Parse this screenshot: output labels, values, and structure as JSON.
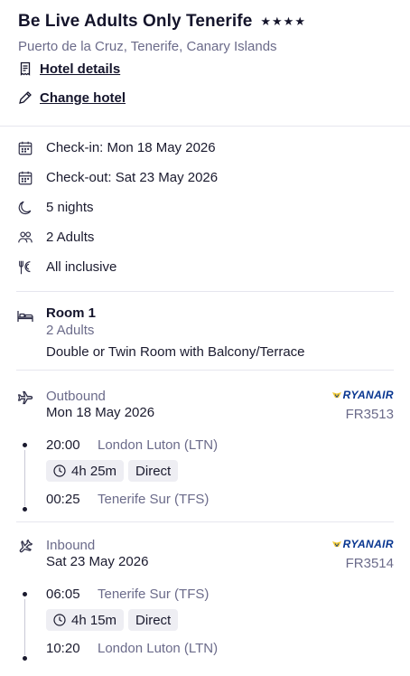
{
  "hotel": {
    "name": "Be Live Adults Only Tenerife",
    "stars": "★★★★",
    "location": "Puerto de la Cruz, Tenerife, Canary Islands",
    "details_link": "Hotel details",
    "change_link": "Change hotel"
  },
  "stay": {
    "checkin": "Check-in: Mon 18 May 2026",
    "checkout": "Check-out: Sat 23 May 2026",
    "nights": "5 nights",
    "guests": "2 Adults",
    "board": "All inclusive"
  },
  "room": {
    "title": "Room 1",
    "guests": "2 Adults",
    "type": "Double or Twin Room with Balcony/Terrace"
  },
  "outbound": {
    "label": "Outbound",
    "date": "Mon 18 May 2026",
    "airline": "RYANAIR",
    "flight_no": "FR3513",
    "depart_time": "20:00",
    "depart_place": "London Luton (LTN)",
    "duration": "4h 25m",
    "stops": "Direct",
    "arrive_time": "00:25",
    "arrive_place": "Tenerife Sur (TFS)"
  },
  "inbound": {
    "label": "Inbound",
    "date": "Sat 23 May 2026",
    "airline": "RYANAIR",
    "flight_no": "FR3514",
    "depart_time": "06:05",
    "depart_place": "Tenerife Sur (TFS)",
    "duration": "4h 15m",
    "stops": "Direct",
    "arrive_time": "10:20",
    "arrive_place": "London Luton (LTN)"
  },
  "colors": {
    "brand_ryanair": "#073590",
    "harp_yellow": "#f1c933",
    "text_primary": "#14142b",
    "text_secondary": "#6b6b8a",
    "chip_bg": "#eeeef3"
  },
  "icons": {
    "details": "receipt-icon",
    "change": "pencil-icon",
    "checkin": "calendar-icon",
    "checkout": "calendar-icon",
    "nights": "moon-icon",
    "guests": "people-icon",
    "board": "cutlery-icon",
    "room": "bed-icon",
    "outbound": "plane-depart-icon",
    "inbound": "plane-arrive-icon",
    "duration": "clock-icon"
  }
}
